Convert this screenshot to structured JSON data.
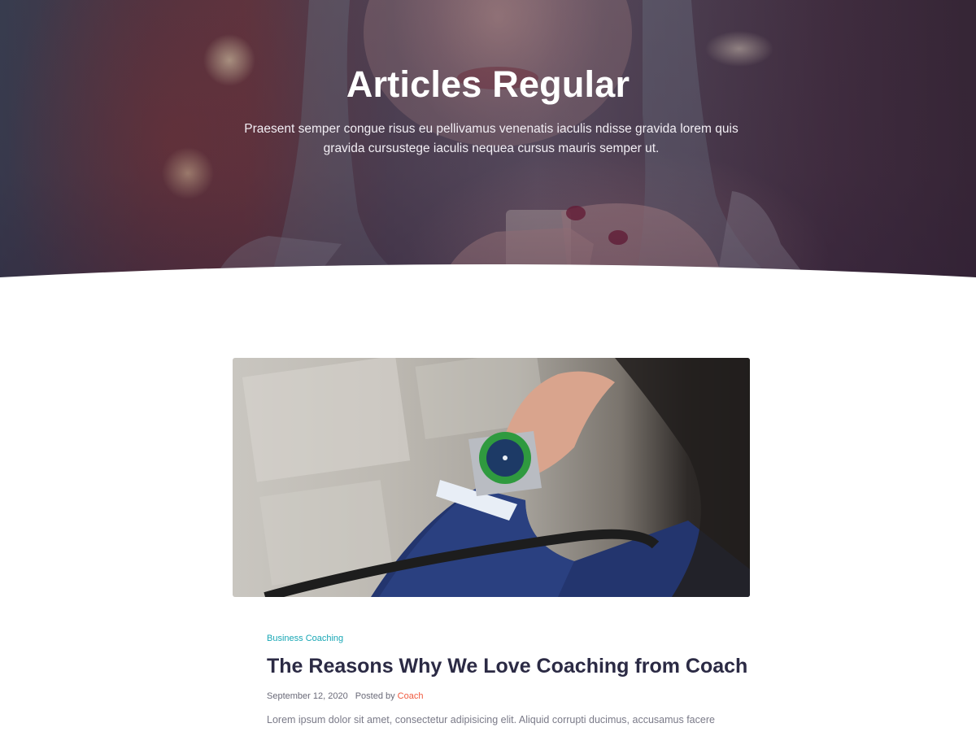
{
  "hero": {
    "title": "Articles Regular",
    "subtitle": "Praesent semper congue risus eu pellivamus venenatis iaculis ndisse gravida lorem quis gravida cursustege iaculis nequea cursus mauris semper ut."
  },
  "post": {
    "category": "Business Coaching",
    "title": "The Reasons Why We Love Coaching from Coach",
    "date": "September 12, 2020",
    "posted_by_label": "Posted by",
    "author": "Coach",
    "excerpt": "Lorem ipsum dolor sit amet, consectetur adipisicing elit. Aliquid corrupti ducimus, accusamus facere"
  },
  "colors": {
    "accent_teal": "#18a7b5",
    "accent_orange": "#f0593e",
    "heading_dark": "#2b2a44"
  }
}
